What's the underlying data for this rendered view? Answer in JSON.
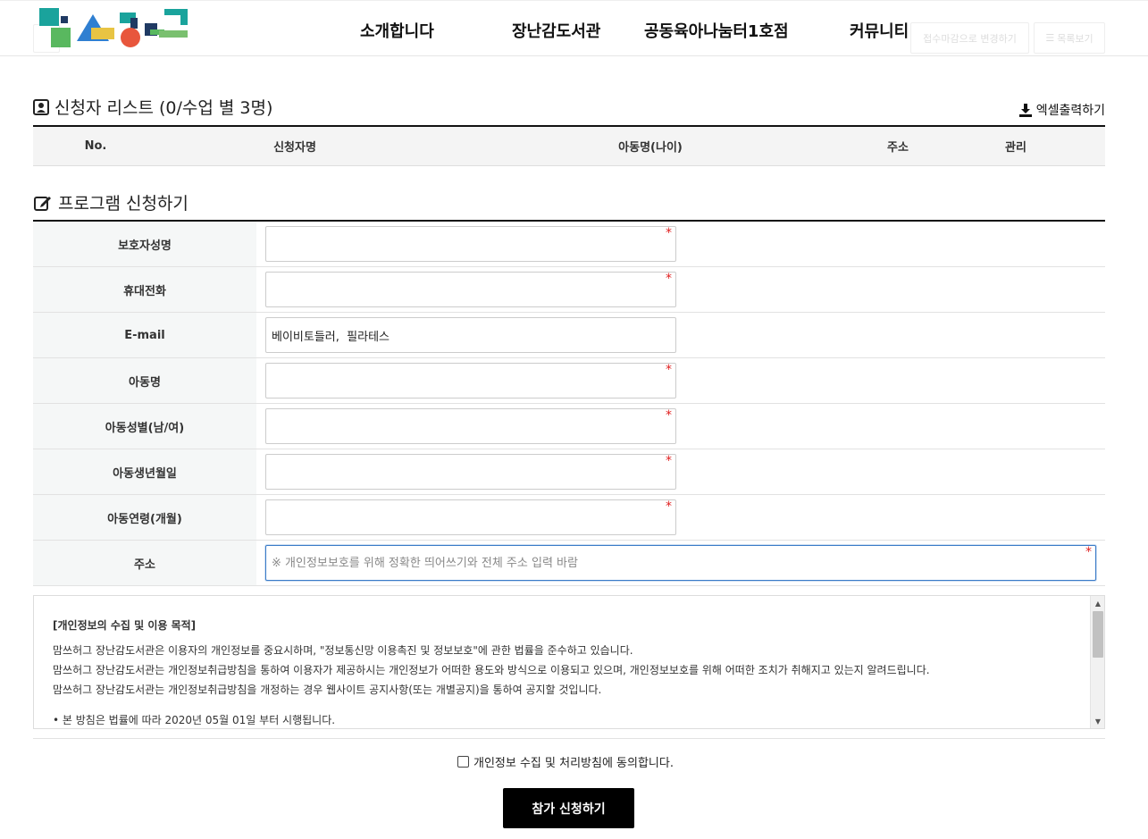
{
  "header": {
    "nav": [
      "소개합니다",
      "장난감도서관",
      "공동육아나눔터1호점",
      "커뮤니티"
    ],
    "ghost_buttons": [
      "접수마감으로 변경하기",
      "목록보기"
    ]
  },
  "applicants": {
    "title": "신청자 리스트 (0/수업 별 3명)",
    "excel_label": "엑셀출력하기",
    "columns": [
      "No.",
      "신청자명",
      "아동명(나이)",
      "주소",
      "관리"
    ]
  },
  "form": {
    "title": "프로그램 신청하기",
    "fields": [
      {
        "label": "보호자성명",
        "value": "",
        "placeholder": "",
        "required": true
      },
      {
        "label": "휴대전화",
        "value": "",
        "placeholder": "",
        "required": true
      },
      {
        "label": "E-mail",
        "value": "베이비토들러,  필라테스",
        "placeholder": "",
        "required": false
      },
      {
        "label": "아동명",
        "value": "",
        "placeholder": "",
        "required": true
      },
      {
        "label": "아동성별(남/여)",
        "value": "",
        "placeholder": "",
        "required": true
      },
      {
        "label": "아동생년월일",
        "value": "",
        "placeholder": "",
        "required": true
      },
      {
        "label": "아동연령(개월)",
        "value": "",
        "placeholder": "",
        "required": true
      },
      {
        "label": "주소",
        "value": "",
        "placeholder": "※ 개인정보보호를 위해 정확한 띄어쓰기와 전체 주소 입력 바람",
        "required": true
      }
    ],
    "required_mark": "*"
  },
  "privacy": {
    "title": "[개인정보의 수집 및 이용 목적]",
    "lines": [
      "맘쓰허그 장난감도서관은 이용자의 개인정보를 중요시하며, \"정보통신망 이용촉진 및 정보보호\"에 관한 법률을 준수하고 있습니다.",
      "맘쓰허그 장난감도서관는 개인정보취급방침을 통하여 이용자가 제공하시는 개인정보가 어떠한 용도와 방식으로 이용되고 있으며, 개인정보보호를 위해 어떠한 조치가 취해지고 있는지 알려드립니다.",
      "맘쓰허그 장난감도서관는 개인정보취급방침을 개정하는 경우 웹사이트 공지사항(또는 개별공지)을 통하여 공지할 것입니다."
    ],
    "footer_line": "• 본 방침은 법률에 따라 2020년 05월 01일 부터 시행됩니다."
  },
  "agree_label": "개인정보 수집 및 처리방침에 동의합니다.",
  "submit_label": "참가 신청하기",
  "colors": {
    "accent_focus": "#3a7bc8",
    "required": "#e02020",
    "label_bg": "#f5f7f7",
    "submit_bg": "#000000"
  }
}
